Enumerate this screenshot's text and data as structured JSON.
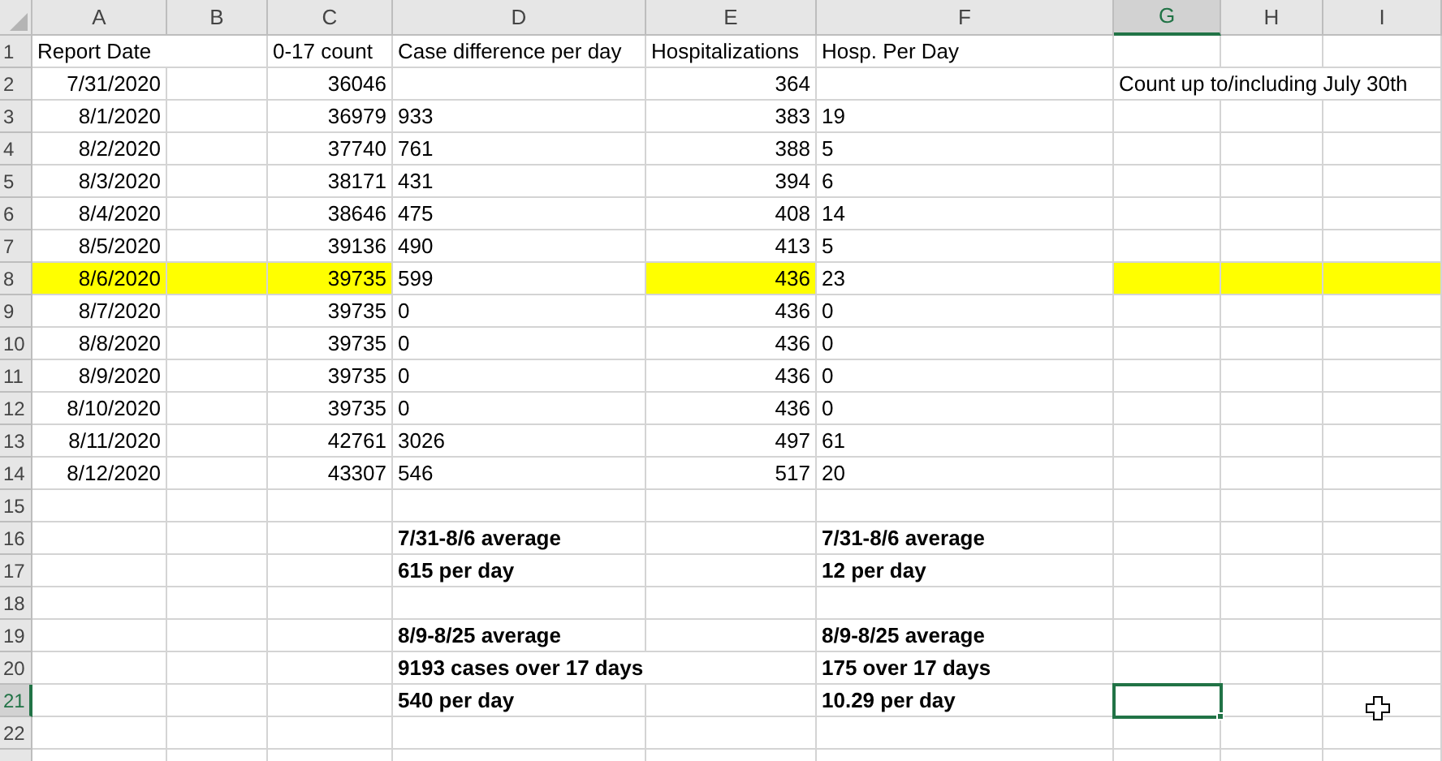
{
  "columns": [
    {
      "label": "A",
      "selected": false
    },
    {
      "label": "B",
      "selected": false
    },
    {
      "label": "C",
      "selected": false
    },
    {
      "label": "D",
      "selected": false
    },
    {
      "label": "E",
      "selected": false
    },
    {
      "label": "F",
      "selected": false
    },
    {
      "label": "G",
      "selected": true
    },
    {
      "label": "H",
      "selected": false
    },
    {
      "label": "I",
      "selected": false
    }
  ],
  "rows": [
    {
      "number": "1",
      "selected": false,
      "cells": {
        "A": {
          "text": "Report Date",
          "kind": "text",
          "selected": false,
          "highlighted": false
        },
        "C": {
          "text": "0-17 count",
          "kind": "text",
          "selected": false,
          "highlighted": false
        },
        "D": {
          "text": "Case difference per day",
          "kind": "text",
          "selected": false,
          "highlighted": false
        },
        "E": {
          "text": "Hospitalizations",
          "kind": "text",
          "selected": false,
          "highlighted": false
        },
        "F": {
          "text": "Hosp. Per Day",
          "kind": "text",
          "selected": false,
          "highlighted": false
        }
      }
    },
    {
      "number": "2",
      "selected": false,
      "cells": {
        "A": {
          "text": "7/31/2020",
          "kind": "number",
          "selected": false,
          "highlighted": false
        },
        "C": {
          "text": "36046",
          "kind": "number",
          "selected": false,
          "highlighted": false
        },
        "E": {
          "text": "364",
          "kind": "number",
          "selected": false,
          "highlighted": false
        },
        "G": {
          "text": "Count up to/including July 30th",
          "kind": "text",
          "selected": false,
          "highlighted": false
        }
      }
    },
    {
      "number": "3",
      "selected": false,
      "cells": {
        "A": {
          "text": "8/1/2020",
          "kind": "number",
          "selected": false,
          "highlighted": false
        },
        "C": {
          "text": "36979",
          "kind": "number",
          "selected": false,
          "highlighted": false
        },
        "D": {
          "text": "933",
          "kind": "text",
          "selected": false,
          "highlighted": false
        },
        "E": {
          "text": "383",
          "kind": "number",
          "selected": false,
          "highlighted": false
        },
        "F": {
          "text": "19",
          "kind": "text",
          "selected": false,
          "highlighted": false
        }
      }
    },
    {
      "number": "4",
      "selected": false,
      "cells": {
        "A": {
          "text": "8/2/2020",
          "kind": "number",
          "selected": false,
          "highlighted": false
        },
        "C": {
          "text": "37740",
          "kind": "number",
          "selected": false,
          "highlighted": false
        },
        "D": {
          "text": "761",
          "kind": "text",
          "selected": false,
          "highlighted": false
        },
        "E": {
          "text": "388",
          "kind": "number",
          "selected": false,
          "highlighted": false
        },
        "F": {
          "text": "5",
          "kind": "text",
          "selected": false,
          "highlighted": false
        }
      }
    },
    {
      "number": "5",
      "selected": false,
      "cells": {
        "A": {
          "text": "8/3/2020",
          "kind": "number",
          "selected": false,
          "highlighted": false
        },
        "C": {
          "text": "38171",
          "kind": "number",
          "selected": false,
          "highlighted": false
        },
        "D": {
          "text": "431",
          "kind": "text",
          "selected": false,
          "highlighted": false
        },
        "E": {
          "text": "394",
          "kind": "number",
          "selected": false,
          "highlighted": false
        },
        "F": {
          "text": "6",
          "kind": "text",
          "selected": false,
          "highlighted": false
        }
      }
    },
    {
      "number": "6",
      "selected": false,
      "cells": {
        "A": {
          "text": "8/4/2020",
          "kind": "number",
          "selected": false,
          "highlighted": false
        },
        "C": {
          "text": "38646",
          "kind": "number",
          "selected": false,
          "highlighted": false
        },
        "D": {
          "text": "475",
          "kind": "text",
          "selected": false,
          "highlighted": false
        },
        "E": {
          "text": "408",
          "kind": "number",
          "selected": false,
          "highlighted": false
        },
        "F": {
          "text": "14",
          "kind": "text",
          "selected": false,
          "highlighted": false
        }
      }
    },
    {
      "number": "7",
      "selected": false,
      "cells": {
        "A": {
          "text": "8/5/2020",
          "kind": "number",
          "selected": false,
          "highlighted": false
        },
        "C": {
          "text": "39136",
          "kind": "number",
          "selected": false,
          "highlighted": false
        },
        "D": {
          "text": "490",
          "kind": "text",
          "selected": false,
          "highlighted": false
        },
        "E": {
          "text": "413",
          "kind": "number",
          "selected": false,
          "highlighted": false
        },
        "F": {
          "text": "5",
          "kind": "text",
          "selected": false,
          "highlighted": false
        }
      }
    },
    {
      "number": "8",
      "selected": false,
      "cells": {
        "A": {
          "text": "8/6/2020",
          "kind": "number",
          "selected": false,
          "highlighted": true
        },
        "B": {
          "selected": false,
          "highlighted": true
        },
        "C": {
          "text": "39735",
          "kind": "number",
          "selected": false,
          "highlighted": true
        },
        "D": {
          "text": "599",
          "kind": "text",
          "selected": false,
          "highlighted": false
        },
        "E": {
          "text": "436",
          "kind": "number",
          "selected": false,
          "highlighted": true
        },
        "F": {
          "text": "23",
          "kind": "text",
          "selected": false,
          "highlighted": false
        },
        "G": {
          "selected": false,
          "highlighted": true
        },
        "H": {
          "selected": false,
          "highlighted": true
        },
        "I": {
          "selected": false,
          "highlighted": true
        }
      }
    },
    {
      "number": "9",
      "selected": false,
      "cells": {
        "A": {
          "text": "8/7/2020",
          "kind": "number",
          "selected": false,
          "highlighted": false
        },
        "C": {
          "text": "39735",
          "kind": "number",
          "selected": false,
          "highlighted": false
        },
        "D": {
          "text": "0",
          "kind": "text",
          "selected": false,
          "highlighted": false
        },
        "E": {
          "text": "436",
          "kind": "number",
          "selected": false,
          "highlighted": false
        },
        "F": {
          "text": "0",
          "kind": "text",
          "selected": false,
          "highlighted": false
        }
      }
    },
    {
      "number": "10",
      "selected": false,
      "cells": {
        "A": {
          "text": "8/8/2020",
          "kind": "number",
          "selected": false,
          "highlighted": false
        },
        "C": {
          "text": "39735",
          "kind": "number",
          "selected": false,
          "highlighted": false
        },
        "D": {
          "text": "0",
          "kind": "text",
          "selected": false,
          "highlighted": false
        },
        "E": {
          "text": "436",
          "kind": "number",
          "selected": false,
          "highlighted": false
        },
        "F": {
          "text": "0",
          "kind": "text",
          "selected": false,
          "highlighted": false
        }
      }
    },
    {
      "number": "11",
      "selected": false,
      "cells": {
        "A": {
          "text": "8/9/2020",
          "kind": "number",
          "selected": false,
          "highlighted": false
        },
        "C": {
          "text": "39735",
          "kind": "number",
          "selected": false,
          "highlighted": false
        },
        "D": {
          "text": "0",
          "kind": "text",
          "selected": false,
          "highlighted": false
        },
        "E": {
          "text": "436",
          "kind": "number",
          "selected": false,
          "highlighted": false
        },
        "F": {
          "text": "0",
          "kind": "text",
          "selected": false,
          "highlighted": false
        }
      }
    },
    {
      "number": "12",
      "selected": false,
      "cells": {
        "A": {
          "text": "8/10/2020",
          "kind": "number",
          "selected": false,
          "highlighted": false
        },
        "C": {
          "text": "39735",
          "kind": "number",
          "selected": false,
          "highlighted": false
        },
        "D": {
          "text": "0",
          "kind": "text",
          "selected": false,
          "highlighted": false
        },
        "E": {
          "text": "436",
          "kind": "number",
          "selected": false,
          "highlighted": false
        },
        "F": {
          "text": "0",
          "kind": "text",
          "selected": false,
          "highlighted": false
        }
      }
    },
    {
      "number": "13",
      "selected": false,
      "cells": {
        "A": {
          "text": "8/11/2020",
          "kind": "number",
          "selected": false,
          "highlighted": false
        },
        "C": {
          "text": "42761",
          "kind": "number",
          "selected": false,
          "highlighted": false
        },
        "D": {
          "text": "3026",
          "kind": "text",
          "selected": false,
          "highlighted": false
        },
        "E": {
          "text": "497",
          "kind": "number",
          "selected": false,
          "highlighted": false
        },
        "F": {
          "text": "61",
          "kind": "text",
          "selected": false,
          "highlighted": false
        }
      }
    },
    {
      "number": "14",
      "selected": false,
      "cells": {
        "A": {
          "text": "8/12/2020",
          "kind": "number",
          "selected": false,
          "highlighted": false
        },
        "C": {
          "text": "43307",
          "kind": "number",
          "selected": false,
          "highlighted": false
        },
        "D": {
          "text": "546",
          "kind": "text",
          "selected": false,
          "highlighted": false
        },
        "E": {
          "text": "517",
          "kind": "number",
          "selected": false,
          "highlighted": false
        },
        "F": {
          "text": "20",
          "kind": "text",
          "selected": false,
          "highlighted": false
        }
      }
    },
    {
      "number": "15",
      "selected": false
    },
    {
      "number": "16",
      "selected": false,
      "cells": {
        "D": {
          "text": "7/31-8/6 average",
          "kind": "text",
          "bold": true,
          "selected": false,
          "highlighted": false
        },
        "F": {
          "text": "7/31-8/6 average",
          "kind": "text",
          "bold": true,
          "selected": false,
          "highlighted": false
        }
      }
    },
    {
      "number": "17",
      "selected": false,
      "cells": {
        "D": {
          "text": "615 per day",
          "kind": "text",
          "bold": true,
          "selected": false,
          "highlighted": false
        },
        "F": {
          "text": "12 per day",
          "kind": "text",
          "bold": true,
          "selected": false,
          "highlighted": false
        }
      }
    },
    {
      "number": "18",
      "selected": false
    },
    {
      "number": "19",
      "selected": false,
      "cells": {
        "D": {
          "text": "8/9-8/25 average",
          "kind": "text",
          "bold": true,
          "selected": false,
          "highlighted": false
        },
        "F": {
          "text": "8/9-8/25 average",
          "kind": "text",
          "bold": true,
          "selected": false,
          "highlighted": false
        }
      }
    },
    {
      "number": "20",
      "selected": false,
      "cells": {
        "D": {
          "text": "9193 cases over 17 days",
          "kind": "text",
          "bold": true,
          "selected": false,
          "highlighted": false
        },
        "F": {
          "text": "175 over 17 days",
          "kind": "text",
          "bold": true,
          "selected": false,
          "highlighted": false
        }
      }
    },
    {
      "number": "21",
      "selected": true,
      "cells": {
        "D": {
          "text": "540 per day",
          "kind": "text",
          "bold": true,
          "selected": false,
          "highlighted": false
        },
        "F": {
          "text": "10.29 per day",
          "kind": "text",
          "bold": true,
          "selected": false,
          "highlighted": false
        },
        "G": {
          "selected": true,
          "highlighted": false
        }
      }
    },
    {
      "number": "22",
      "selected": false
    }
  ]
}
